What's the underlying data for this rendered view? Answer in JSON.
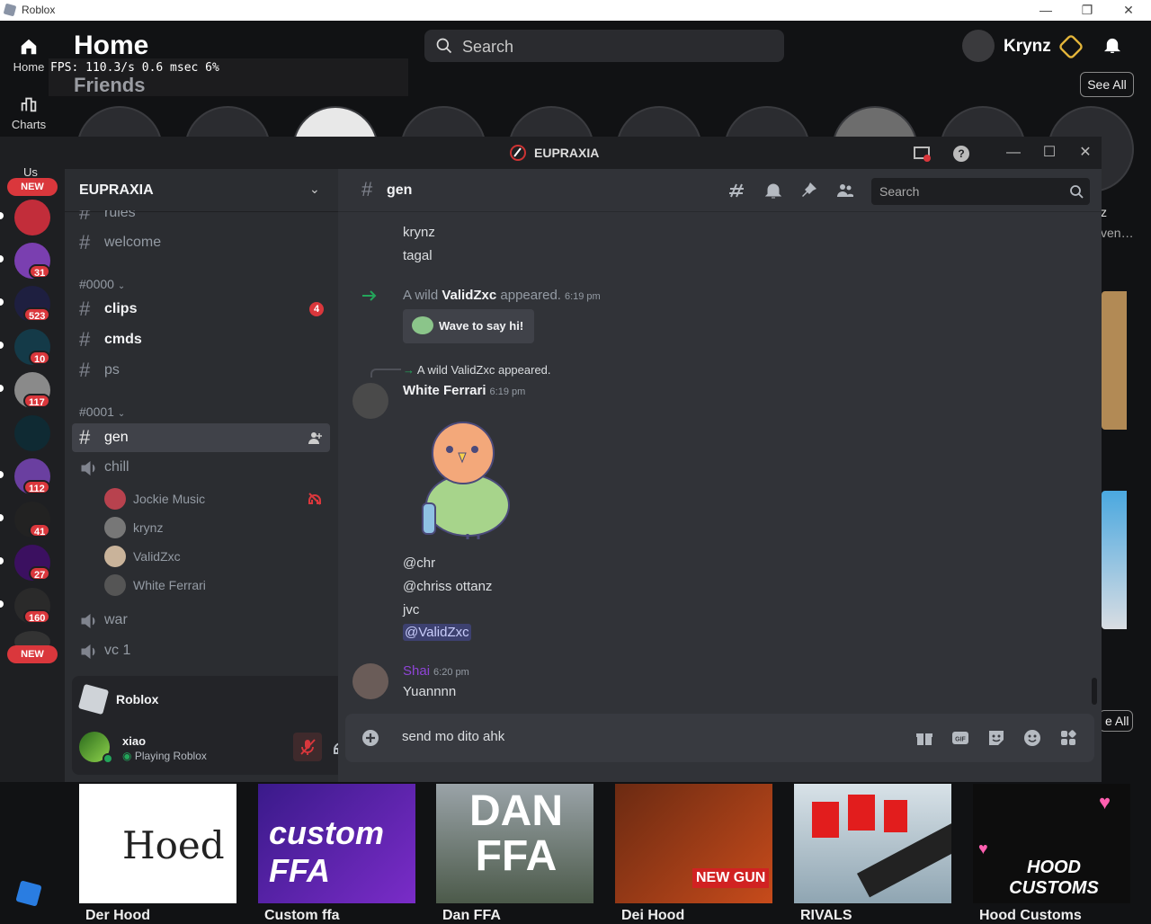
{
  "roblox": {
    "window_title": "Roblox",
    "nav": [
      {
        "label": "Home"
      },
      {
        "label": "Charts"
      }
    ],
    "page_title": "Home",
    "section_friends": "Friends",
    "fps_overlay": "FPS: 110.3/s 0.6 msec 6%",
    "search_placeholder": "Search",
    "username": "Krynz",
    "see_all": "See All",
    "see_all_2": "e All",
    "right_text_1": "z",
    "right_text_2": "ven…",
    "games": [
      {
        "title": "Der Hood",
        "thumb_text": "Hoed"
      },
      {
        "title": "Custom ffa",
        "thumb_text": "custom FFA"
      },
      {
        "title": "Dan FFA",
        "thumb_text": "DAN FFA"
      },
      {
        "title": "Dei Hood",
        "thumb_text": "NEW GUN"
      },
      {
        "title": "RIVALS",
        "thumb_text": ""
      },
      {
        "title": "Hood Customs",
        "thumb_text": "HOOD CUSTOMS"
      }
    ]
  },
  "discord": {
    "window_title": "EUPRAXIA",
    "guilds": [
      {
        "badge": "NEW",
        "type": "new"
      },
      {
        "badge": ""
      },
      {
        "badge": "31"
      },
      {
        "badge": "523"
      },
      {
        "badge": "10"
      },
      {
        "badge": "117"
      },
      {
        "badge": ""
      },
      {
        "badge": "112"
      },
      {
        "badge": "41"
      },
      {
        "badge": "27"
      },
      {
        "badge": "160"
      },
      {
        "badge": "NEW",
        "type": "new"
      }
    ],
    "guild_top_partial": "Us",
    "server_name": "EUPRAXIA",
    "channels": {
      "partial_top": "rules",
      "welcome": "welcome",
      "cat1": "#0000",
      "clips": "clips",
      "clips_badge": "4",
      "cmds": "cmds",
      "ps": "ps",
      "cat2": "#0001",
      "gen": "gen",
      "chill": "chill",
      "voice_users": [
        "Jockie Music",
        "krynz",
        "ValidZxc",
        "White Ferrari"
      ],
      "war": "war",
      "vc1": "vc 1"
    },
    "activity": {
      "app": "Roblox"
    },
    "user": {
      "name": "xiao",
      "status": "Playing Roblox"
    },
    "chat": {
      "channel": "gen",
      "search_placeholder": "Search",
      "messages": {
        "line1": "krynz",
        "line2": "tagal",
        "join_prefix": "A wild ",
        "join_user": "ValidZxc",
        "join_suffix": " appeared.",
        "join_time": "6:19 pm",
        "wave_button": "Wave to say hi!",
        "reply_ref": "A wild ValidZxc appeared.",
        "author1": "White Ferrari",
        "author1_time": "6:19 pm",
        "m1": "@chr",
        "m2": "@chriss ottanz",
        "m3": "jvc",
        "m4": "@ValidZxc",
        "author2": "Shai",
        "author2_time": "6:20 pm",
        "m5": "Yuannnn"
      },
      "composer_value": "send mo dito ahk"
    }
  },
  "colors": {
    "accent_red": "#da373c",
    "mention_bg": "#3c4270",
    "shai_name": "#8e44d6",
    "join_arrow": "#23a55a"
  }
}
